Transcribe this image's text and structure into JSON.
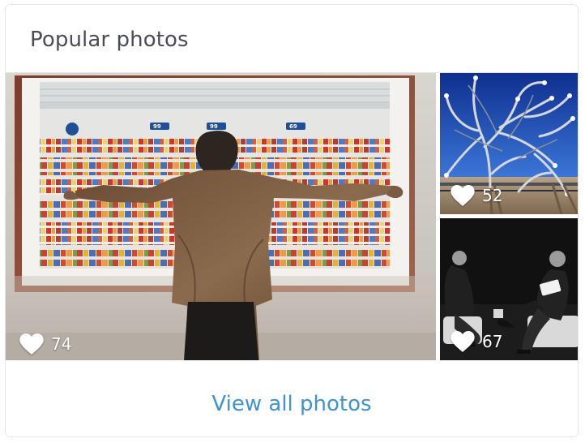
{
  "card": {
    "title": "Popular photos",
    "view_all_label": "View all photos",
    "accent_color": "#3d93d6",
    "title_color": "#4a4d55"
  },
  "photos": [
    {
      "likes": "74",
      "icon": "heart-icon"
    },
    {
      "likes": "52",
      "icon": "heart-icon"
    },
    {
      "likes": "67",
      "icon": "heart-icon"
    }
  ],
  "large_photo": {
    "price_signs": [
      "99",
      "99",
      "69"
    ]
  }
}
